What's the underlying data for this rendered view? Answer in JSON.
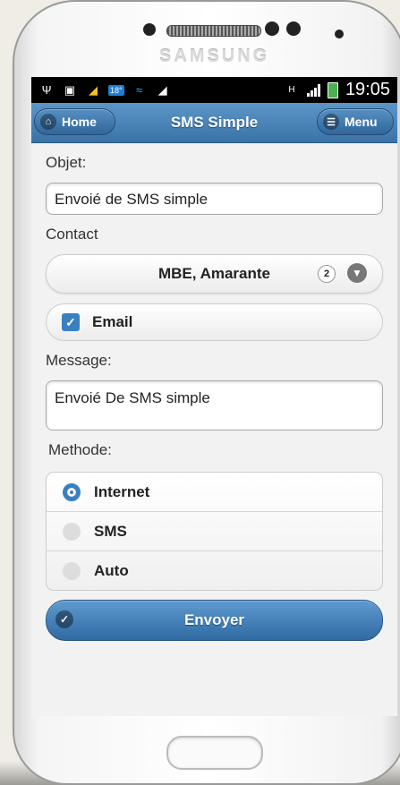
{
  "device": {
    "brand": "SAMSUNG"
  },
  "statusbar": {
    "icons": [
      "usb-icon",
      "image-icon",
      "broom-icon",
      "weather-badge",
      "wifi-icon",
      "broom-icon",
      "network-type-icon",
      "signal-icon",
      "battery-icon"
    ],
    "temperature": "18°",
    "network_type": "H",
    "time": "19:05"
  },
  "header": {
    "title": "SMS Simple",
    "home_label": "Home",
    "menu_label": "Menu",
    "color": "#3f78ab"
  },
  "form": {
    "objet_label": "Objet:",
    "objet_value": "Envoié de SMS simple",
    "contact_label": "Contact",
    "contact_value": "MBE, Amarante",
    "contact_count": "2",
    "email_label": "Email",
    "email_checked": true,
    "message_label": "Message:",
    "message_value": "Envoié De SMS simple",
    "methode_label": "Methode:",
    "methods": [
      {
        "label": "Internet",
        "selected": true
      },
      {
        "label": "SMS",
        "selected": false
      },
      {
        "label": "Auto",
        "selected": false
      }
    ],
    "submit_label": "Envoyer"
  },
  "colors": {
    "accent": "#3a7fc1",
    "background": "#f2f2f2"
  }
}
